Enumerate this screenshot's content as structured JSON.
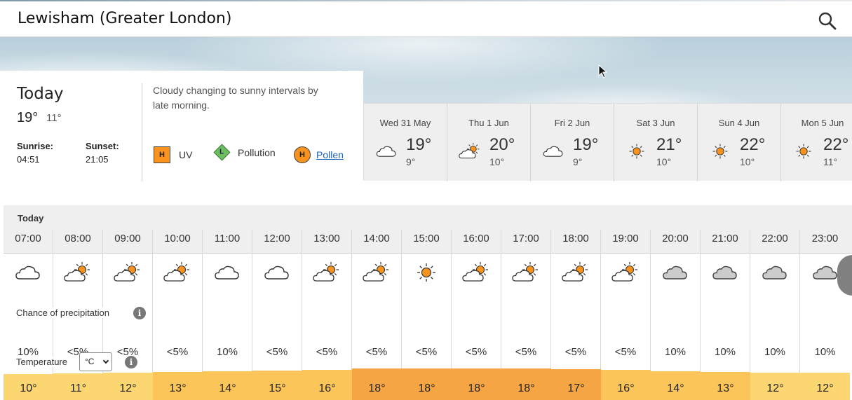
{
  "location": {
    "title": "Lewisham (Greater London)"
  },
  "today": {
    "label": "Today",
    "high": "19°",
    "low": "11°",
    "sunrise_label": "Sunrise:",
    "sunrise": "04:51",
    "sunset_label": "Sunset:",
    "sunset": "21:05",
    "summary": "Cloudy changing to sunny intervals by late morning.",
    "uv": {
      "badge": "H",
      "label": "UV",
      "color": "#f7931e"
    },
    "pollution": {
      "badge": "L",
      "label": "Pollution",
      "color": "#6bbd5f"
    },
    "pollen": {
      "badge": "H",
      "label": "Pollen",
      "color": "#f7931e"
    }
  },
  "days": [
    {
      "name": "Wed 31 May",
      "icon": "cloud-icon",
      "high": "19°",
      "low": "9°"
    },
    {
      "name": "Thu 1 Jun",
      "icon": "sun-cloud-icon",
      "high": "20°",
      "low": "10°"
    },
    {
      "name": "Fri 2 Jun",
      "icon": "cloud-icon",
      "high": "19°",
      "low": "9°"
    },
    {
      "name": "Sat 3 Jun",
      "icon": "sun-icon",
      "high": "21°",
      "low": "10°"
    },
    {
      "name": "Sun 4 Jun",
      "icon": "sun-icon",
      "high": "22°",
      "low": "10°"
    },
    {
      "name": "Mon 5 Jun",
      "icon": "sun-icon",
      "high": "22°",
      "low": "11°"
    }
  ],
  "hourly": {
    "day_label": "Today",
    "precip_label": "Chance of precipitation",
    "temp_label": "Temperature",
    "unit": "°C",
    "hours": [
      {
        "time": "07:00",
        "icon": "cloud-icon",
        "precip": "10%",
        "temp": "10°",
        "temp_value": 10
      },
      {
        "time": "08:00",
        "icon": "sun-cloud-icon",
        "precip": "<5%",
        "temp": "11°",
        "temp_value": 11
      },
      {
        "time": "09:00",
        "icon": "sun-cloud-icon",
        "precip": "<5%",
        "temp": "12°",
        "temp_value": 12
      },
      {
        "time": "10:00",
        "icon": "sun-cloud-icon",
        "precip": "<5%",
        "temp": "13°",
        "temp_value": 13
      },
      {
        "time": "11:00",
        "icon": "cloud-icon",
        "precip": "10%",
        "temp": "14°",
        "temp_value": 14
      },
      {
        "time": "12:00",
        "icon": "cloud-icon",
        "precip": "<5%",
        "temp": "15°",
        "temp_value": 15
      },
      {
        "time": "13:00",
        "icon": "sun-cloud-icon",
        "precip": "<5%",
        "temp": "16°",
        "temp_value": 16
      },
      {
        "time": "14:00",
        "icon": "sun-cloud-icon",
        "precip": "<5%",
        "temp": "18°",
        "temp_value": 18
      },
      {
        "time": "15:00",
        "icon": "sun-icon",
        "precip": "<5%",
        "temp": "18°",
        "temp_value": 18
      },
      {
        "time": "16:00",
        "icon": "sun-cloud-icon",
        "precip": "<5%",
        "temp": "18°",
        "temp_value": 18
      },
      {
        "time": "17:00",
        "icon": "sun-cloud-icon",
        "precip": "<5%",
        "temp": "18°",
        "temp_value": 18
      },
      {
        "time": "18:00",
        "icon": "sun-cloud-icon",
        "precip": "<5%",
        "temp": "17°",
        "temp_value": 17
      },
      {
        "time": "19:00",
        "icon": "sun-cloud-icon",
        "precip": "<5%",
        "temp": "16°",
        "temp_value": 16
      },
      {
        "time": "20:00",
        "icon": "grey-cloud-icon",
        "precip": "10%",
        "temp": "14°",
        "temp_value": 14
      },
      {
        "time": "21:00",
        "icon": "grey-cloud-icon",
        "precip": "10%",
        "temp": "13°",
        "temp_value": 13
      },
      {
        "time": "22:00",
        "icon": "grey-cloud-icon",
        "precip": "10%",
        "temp": "12°",
        "temp_value": 12
      },
      {
        "time": "23:00",
        "icon": "grey-cloud-icon",
        "precip": "10%",
        "temp": "12°",
        "temp_value": 12
      }
    ]
  },
  "colors": {
    "temp_warm": "#f6a545",
    "temp_mild": "#fbc55a",
    "temp_cool": "#fcd670",
    "sun": "#f7931e"
  }
}
